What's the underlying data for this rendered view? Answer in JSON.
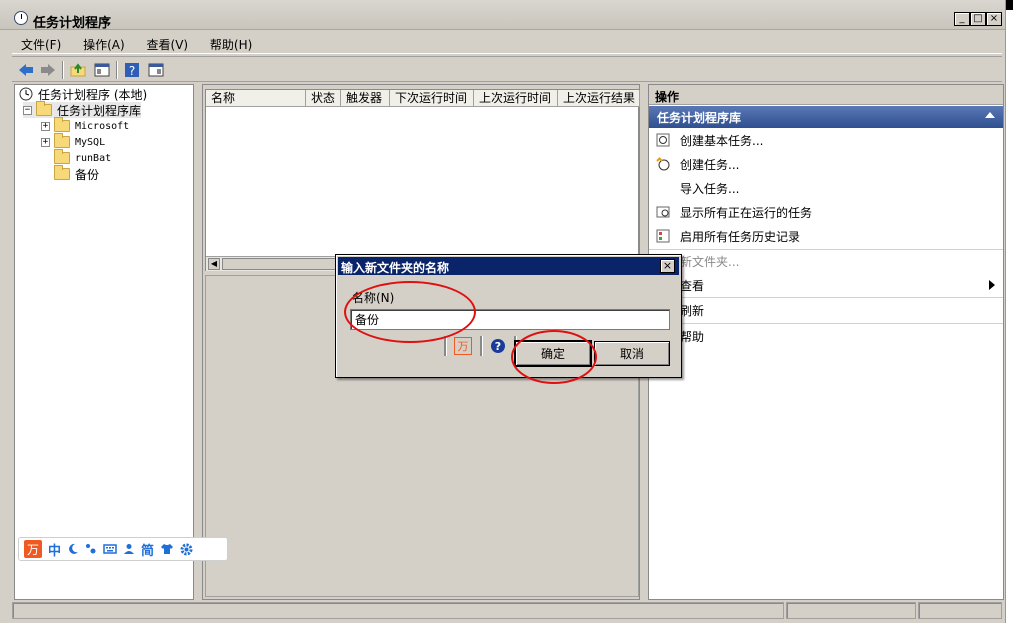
{
  "window": {
    "title": "任务计划程序",
    "buttons": {
      "minimize": "_",
      "maximize": "□",
      "close": "×"
    }
  },
  "menu": [
    "文件(F)",
    "操作(A)",
    "查看(V)",
    "帮助(H)"
  ],
  "tree": {
    "root": "任务计划程序 (本地)",
    "library": "任务计划程序库",
    "children": [
      "Microsoft",
      "MySQL",
      "runBat",
      "备份"
    ]
  },
  "list": {
    "columns": [
      "名称",
      "状态",
      "触发器",
      "下次运行时间",
      "上次运行时间",
      "上次运行结果"
    ]
  },
  "actions": {
    "header": "操作",
    "section": "任务计划程序库",
    "items": [
      "创建基本任务...",
      "创建任务...",
      "导入任务...",
      "显示所有正在运行的任务",
      "启用所有任务历史记录",
      "新文件夹...",
      "查看",
      "刷新",
      "帮助"
    ]
  },
  "dialog": {
    "title": "输入新文件夹的名称",
    "label": "名称(N)",
    "value": "备份",
    "ok": "确定",
    "cancel": "取消",
    "close": "×"
  },
  "ime": {
    "items": [
      "中",
      "简"
    ]
  },
  "colors": {
    "dialog_title_bg": "#0a246a",
    "actions_section_bg": "#2f4f8f",
    "annotation": "#e01010",
    "ime_accent": "#1e6fd9",
    "ime_logo": "#f05a22"
  }
}
